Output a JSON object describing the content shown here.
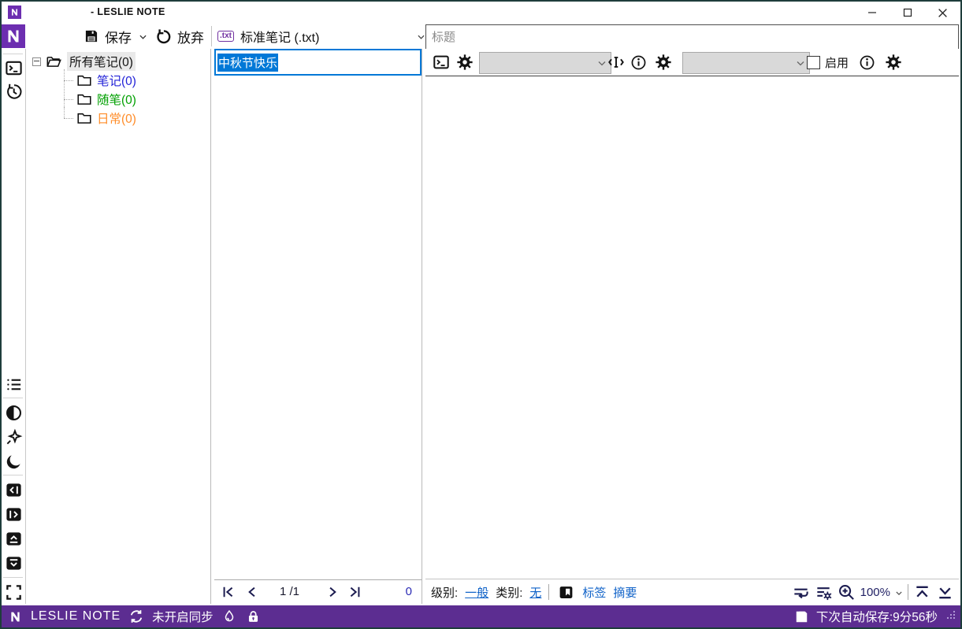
{
  "window": {
    "title": "- LESLIE NOTE",
    "controls": [
      "minimize",
      "maximize",
      "close"
    ]
  },
  "colors": {
    "accent_purple": "#6c2eb0",
    "statusbar_purple": "#5c2d91",
    "selection_blue": "#0078d7",
    "link_blue": "#0f62c8",
    "window_border": "#1e3d3c",
    "txt_badge_purple": "#7030a0"
  },
  "toolbar": {
    "save_label": "保存",
    "discard_label": "放弃"
  },
  "note_type_selector": {
    "badge": ".txt",
    "label": "标准笔记 (.txt)"
  },
  "title_input": {
    "placeholder": "标题"
  },
  "sidebar": {
    "top_icons": [
      "app-logo",
      "terminal-icon",
      "history-icon"
    ],
    "bottom_icons": [
      "list-icon",
      "contrast-icon",
      "pin-icon",
      "moon-icon",
      "collapse-left-icon",
      "collapse-right-icon",
      "collapse-up-icon",
      "collapse-down-icon",
      "fullscreen-icon"
    ]
  },
  "tree": {
    "root_label": "所有笔记(0)",
    "folders": [
      {
        "label": "笔记(0)",
        "color": "#2323d8"
      },
      {
        "label": "随笔(0)",
        "color": "#00a000"
      },
      {
        "label": "日常(0)",
        "color": "#ff8c28"
      }
    ]
  },
  "note_list": {
    "selected_item_title": "中秋节快乐",
    "pagination": {
      "page_display": "1 /1",
      "count": "0"
    }
  },
  "editor_toolbar": {
    "enable_label": "启用",
    "icons": [
      "terminal-icon",
      "gear-icon",
      "text-cursor-icon",
      "info-icon",
      "gear-icon",
      "info-icon",
      "gear-icon"
    ]
  },
  "editor_meta_bar": {
    "level_label": "级别:",
    "level_value": "一般",
    "category_label": "类别:",
    "category_value": "无",
    "tags_label": "标签",
    "summary_label": "摘要",
    "zoom_value": "100%",
    "icons": [
      "bookmark-icon",
      "word-wrap-icon",
      "list-settings-icon",
      "zoom-in-icon",
      "scroll-top-icon",
      "scroll-bottom-icon"
    ]
  },
  "status_bar": {
    "app_name": "LESLIE NOTE",
    "sync_status": "未开启同步",
    "autosave_text": "下次自动保存:9分56秒",
    "icons": [
      "app-logo",
      "sync-icon",
      "flame-icon",
      "lock-icon",
      "save-icon",
      "resize-grip"
    ]
  }
}
